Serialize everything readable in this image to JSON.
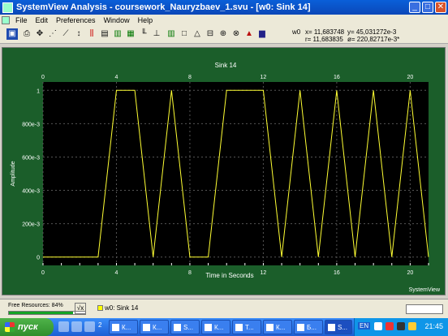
{
  "window": {
    "title": "SystemView Analysis - coursework_Nauryzbaev_1.svu - [w0: Sink 14]",
    "min": "_",
    "max": "□",
    "close": "✕"
  },
  "menu": [
    "File",
    "Edit",
    "Preferences",
    "Window",
    "Help"
  ],
  "readout": {
    "label": "w0",
    "x": "x= 11,683748",
    "y": "y= 45,031272e-3",
    "r": "r= 11,683835",
    "theta": "ø= 220,82717e-3*"
  },
  "plot": {
    "brand": "SystemView"
  },
  "chart_data": {
    "type": "line",
    "title": "Sink 14",
    "xlabel": "Time in Seconds",
    "ylabel": "Amplitude",
    "xlim": [
      0,
      21
    ],
    "ylim": [
      -0.05,
      1.05
    ],
    "x_ticks": [
      "0",
      "4",
      "8",
      "12",
      "16",
      "20"
    ],
    "y_ticks": [
      "0",
      "200e-3",
      "400e-3",
      "600e-3",
      "800e-3",
      "1"
    ],
    "grid": true,
    "line_color": "#ffff33",
    "background": "#000000",
    "series": [
      {
        "x": [
          0,
          3,
          4,
          5,
          6,
          7,
          8,
          9,
          10,
          12,
          13,
          14,
          15,
          16,
          17,
          18,
          19,
          20,
          21
        ],
        "values": [
          0,
          0,
          1,
          1,
          0,
          1,
          0,
          0,
          1,
          1,
          0,
          1,
          0,
          1,
          0,
          1,
          0,
          1,
          0
        ]
      }
    ]
  },
  "status": {
    "free_resources": "Free Resources: 84%",
    "free_resources_value": 84,
    "sqrt_btn": "√x",
    "window_tab": "w0: Sink 14"
  },
  "taskbar": {
    "start": "пуск",
    "tasks": [
      "2",
      "К...",
      "К...",
      "S...",
      "К...",
      "Т...",
      "К...",
      "Б...",
      "S..."
    ],
    "clock": "21:45",
    "lang": "EN"
  }
}
